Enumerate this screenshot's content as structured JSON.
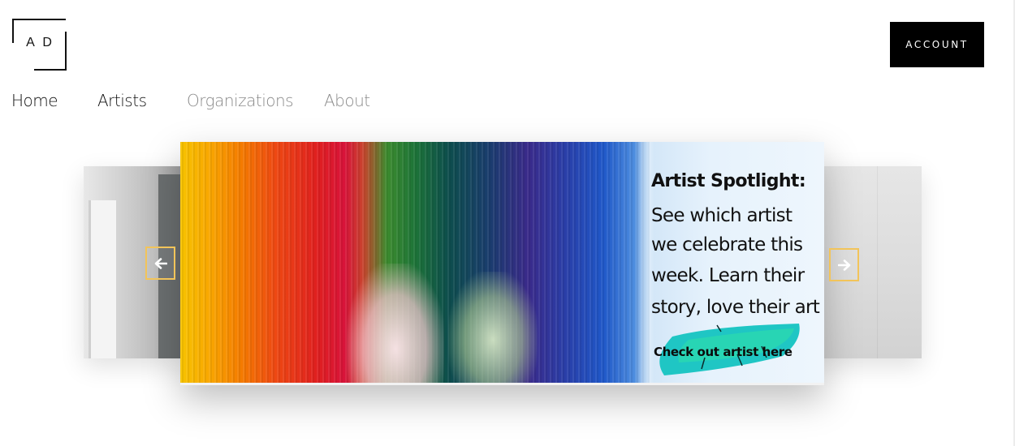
{
  "header": {
    "logo_text": "AD",
    "account_label": "ACCOUNT"
  },
  "nav": {
    "items": [
      {
        "label": "Home"
      },
      {
        "label": "Artists"
      },
      {
        "label": "Organizations"
      },
      {
        "label": "About"
      }
    ]
  },
  "carousel": {
    "slide": {
      "title": "Artist Spotlight:",
      "lines": [
        "See which artist",
        "we celebrate this",
        "week. Learn their",
        "story, love their art"
      ],
      "cta": "Check out artist here"
    },
    "prev_icon": "arrow-left-icon",
    "next_icon": "arrow-right-icon"
  },
  "colors": {
    "accent_border": "#f2c45a",
    "account_bg": "#000000",
    "nav_active": "#111111",
    "nav_inactive": "#8a8a8a"
  }
}
